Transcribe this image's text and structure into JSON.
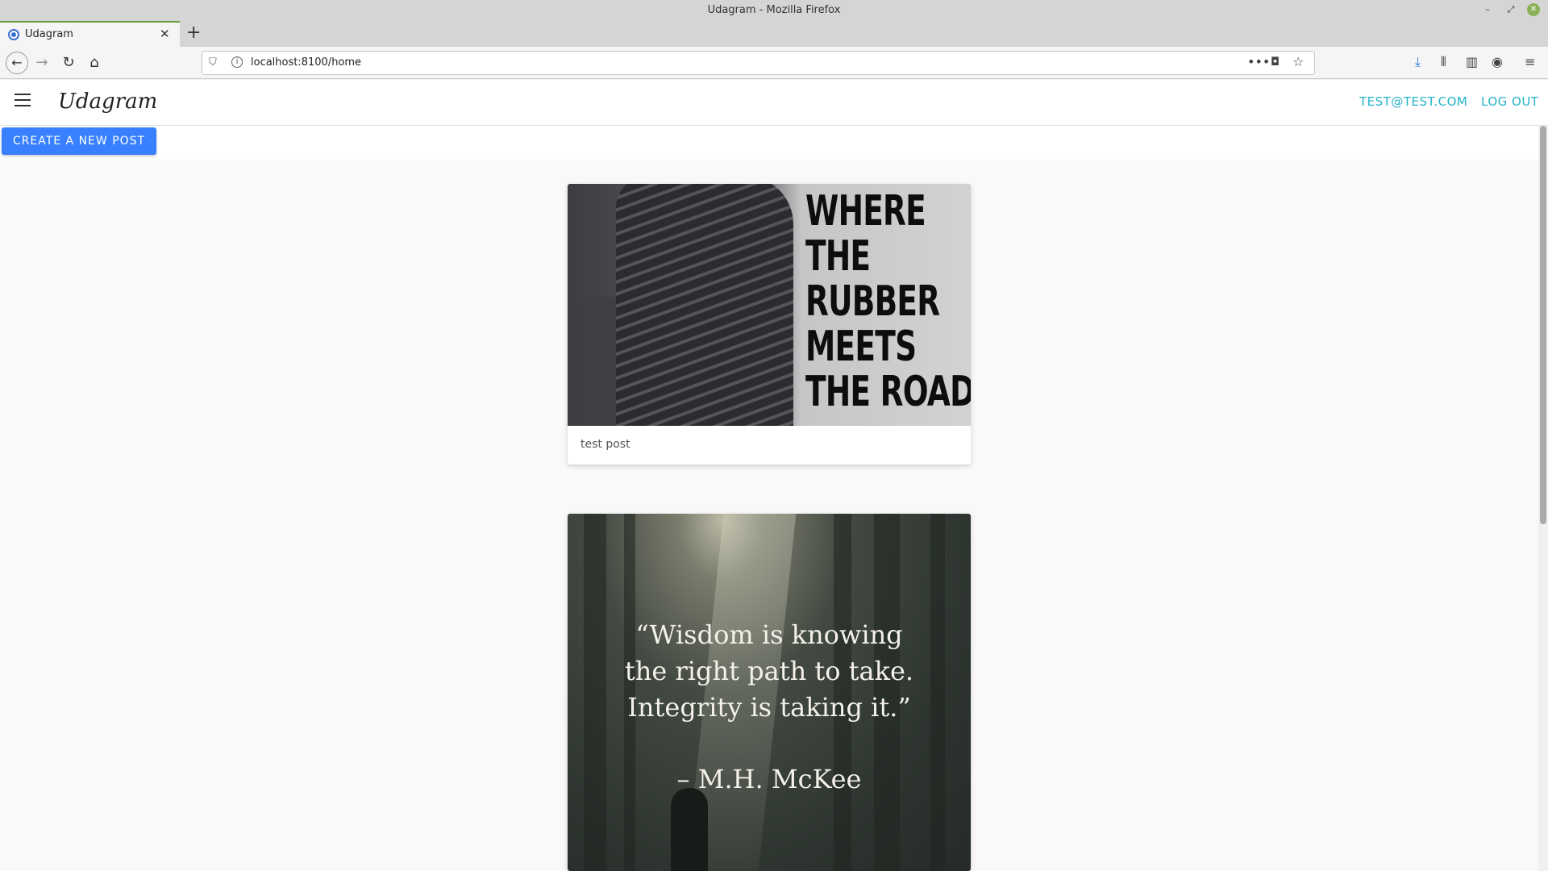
{
  "window": {
    "title": "Udagram - Mozilla Firefox"
  },
  "browser": {
    "tab_label": "Udagram",
    "url": "localhost:8100/home"
  },
  "app": {
    "title": "Udagram",
    "user_email": "TEST@TEST.COM",
    "logout_label": "LOG OUT",
    "create_button_label": "CREATE A NEW POST"
  },
  "posts": [
    {
      "image_text": [
        "WHERE",
        "THE",
        "RUBBER",
        "MEETS",
        "THE ROAD."
      ],
      "caption": "test post"
    },
    {
      "quote_lines": [
        "“Wisdom is knowing",
        "the right path to take.",
        "Integrity is taking it.”"
      ],
      "author": "– M.H. McKee"
    }
  ],
  "colors": {
    "accent": "#3880ff",
    "header_link": "#24b4c8"
  }
}
